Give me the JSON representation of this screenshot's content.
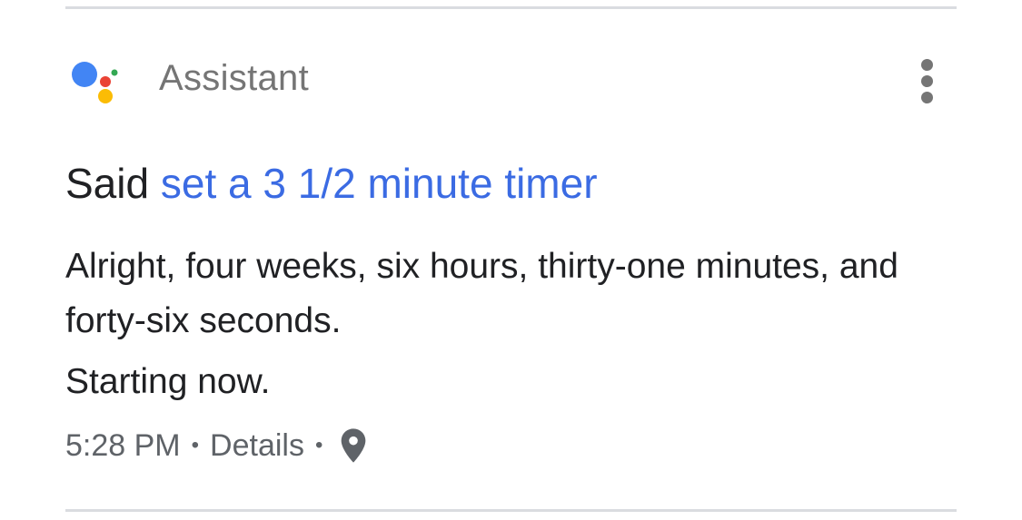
{
  "header": {
    "app_name": "Assistant"
  },
  "entry": {
    "said_prefix": "Said",
    "query": "set a 3 1/2 minute timer",
    "response_line_1": "Alright, four weeks, six hours, thirty-one minutes, and forty-six seconds.",
    "response_line_2": "Starting now.",
    "time": "5:28 PM",
    "separator": "•",
    "details_label": "Details"
  },
  "icons": {
    "logo": "google-assistant-logo",
    "menu": "more-vert-icon",
    "location": "location-pin-icon"
  },
  "colors": {
    "query_blue": "#3b6be3",
    "dot_blue": "#4285f4",
    "dot_red": "#ea4335",
    "dot_yellow": "#fbbc05",
    "dot_green": "#34a853",
    "secondary_text": "#5f6368",
    "primary_text": "#202124",
    "divider": "#dadce0"
  }
}
